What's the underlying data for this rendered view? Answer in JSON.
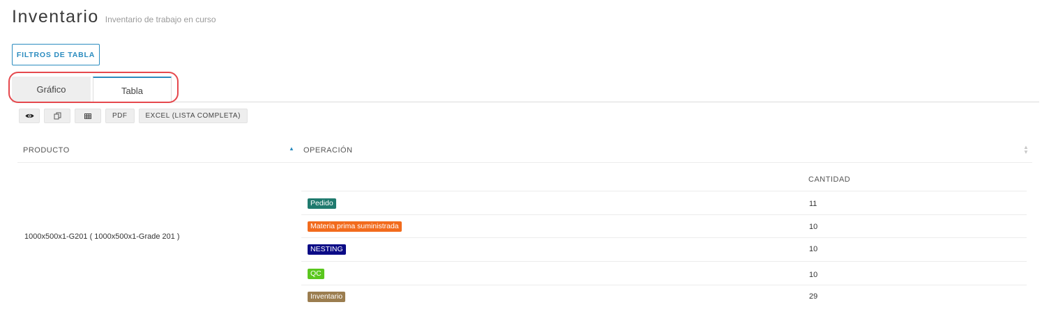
{
  "header": {
    "title": "Inventario",
    "subtitle": "Inventario de trabajo en curso"
  },
  "filters_button": "FILTROS DE TABLA",
  "tabs": [
    {
      "label": "Gráfico",
      "active": false
    },
    {
      "label": "Tabla",
      "active": true
    }
  ],
  "toolbar": {
    "view_icon": "eye-icon",
    "copy_icon": "copy-icon",
    "columns_icon": "table-icon",
    "pdf_label": "PDF",
    "excel_label": "EXCEL (LISTA COMPLETA)"
  },
  "table": {
    "columns": [
      "PRODUCTO",
      "OPERACIÓN"
    ],
    "sort": {
      "column": "PRODUCTO",
      "direction": "asc"
    },
    "subheader": "CANTIDAD",
    "product": "1000x500x1-G201 ( 1000x500x1-Grade 201 )",
    "operations": [
      {
        "label": "Pedido",
        "color": "#1f7a6e",
        "quantity": "11"
      },
      {
        "label": "Materia prima suministrada",
        "color": "#f26b1d",
        "quantity": "10"
      },
      {
        "label": "NESTING",
        "color": "#0b0b86",
        "quantity": "10"
      },
      {
        "label": "QC",
        "color": "#5ac71e",
        "quantity": "10"
      },
      {
        "label": "Inventario",
        "color": "#9b7d4f",
        "quantity": "29"
      }
    ]
  },
  "colors": {
    "accent": "#2a8bbf",
    "highlight_outline": "#e5484d"
  }
}
